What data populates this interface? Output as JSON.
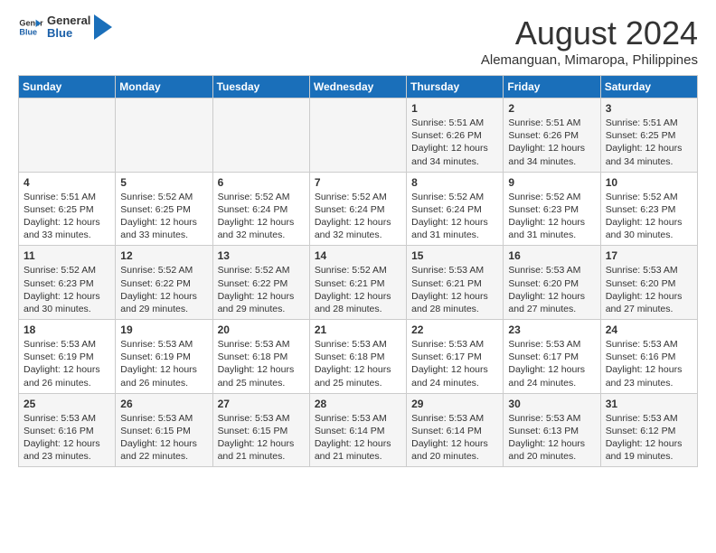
{
  "header": {
    "logo_line1": "General",
    "logo_line2": "Blue",
    "title": "August 2024",
    "subtitle": "Alemanguan, Mimaropa, Philippines"
  },
  "days_of_week": [
    "Sunday",
    "Monday",
    "Tuesday",
    "Wednesday",
    "Thursday",
    "Friday",
    "Saturday"
  ],
  "weeks": [
    [
      {
        "date": "",
        "info": ""
      },
      {
        "date": "",
        "info": ""
      },
      {
        "date": "",
        "info": ""
      },
      {
        "date": "",
        "info": ""
      },
      {
        "date": "1",
        "info": "Sunrise: 5:51 AM\nSunset: 6:26 PM\nDaylight: 12 hours\nand 34 minutes."
      },
      {
        "date": "2",
        "info": "Sunrise: 5:51 AM\nSunset: 6:26 PM\nDaylight: 12 hours\nand 34 minutes."
      },
      {
        "date": "3",
        "info": "Sunrise: 5:51 AM\nSunset: 6:25 PM\nDaylight: 12 hours\nand 34 minutes."
      }
    ],
    [
      {
        "date": "4",
        "info": "Sunrise: 5:51 AM\nSunset: 6:25 PM\nDaylight: 12 hours\nand 33 minutes."
      },
      {
        "date": "5",
        "info": "Sunrise: 5:52 AM\nSunset: 6:25 PM\nDaylight: 12 hours\nand 33 minutes."
      },
      {
        "date": "6",
        "info": "Sunrise: 5:52 AM\nSunset: 6:24 PM\nDaylight: 12 hours\nand 32 minutes."
      },
      {
        "date": "7",
        "info": "Sunrise: 5:52 AM\nSunset: 6:24 PM\nDaylight: 12 hours\nand 32 minutes."
      },
      {
        "date": "8",
        "info": "Sunrise: 5:52 AM\nSunset: 6:24 PM\nDaylight: 12 hours\nand 31 minutes."
      },
      {
        "date": "9",
        "info": "Sunrise: 5:52 AM\nSunset: 6:23 PM\nDaylight: 12 hours\nand 31 minutes."
      },
      {
        "date": "10",
        "info": "Sunrise: 5:52 AM\nSunset: 6:23 PM\nDaylight: 12 hours\nand 30 minutes."
      }
    ],
    [
      {
        "date": "11",
        "info": "Sunrise: 5:52 AM\nSunset: 6:23 PM\nDaylight: 12 hours\nand 30 minutes."
      },
      {
        "date": "12",
        "info": "Sunrise: 5:52 AM\nSunset: 6:22 PM\nDaylight: 12 hours\nand 29 minutes."
      },
      {
        "date": "13",
        "info": "Sunrise: 5:52 AM\nSunset: 6:22 PM\nDaylight: 12 hours\nand 29 minutes."
      },
      {
        "date": "14",
        "info": "Sunrise: 5:52 AM\nSunset: 6:21 PM\nDaylight: 12 hours\nand 28 minutes."
      },
      {
        "date": "15",
        "info": "Sunrise: 5:53 AM\nSunset: 6:21 PM\nDaylight: 12 hours\nand 28 minutes."
      },
      {
        "date": "16",
        "info": "Sunrise: 5:53 AM\nSunset: 6:20 PM\nDaylight: 12 hours\nand 27 minutes."
      },
      {
        "date": "17",
        "info": "Sunrise: 5:53 AM\nSunset: 6:20 PM\nDaylight: 12 hours\nand 27 minutes."
      }
    ],
    [
      {
        "date": "18",
        "info": "Sunrise: 5:53 AM\nSunset: 6:19 PM\nDaylight: 12 hours\nand 26 minutes."
      },
      {
        "date": "19",
        "info": "Sunrise: 5:53 AM\nSunset: 6:19 PM\nDaylight: 12 hours\nand 26 minutes."
      },
      {
        "date": "20",
        "info": "Sunrise: 5:53 AM\nSunset: 6:18 PM\nDaylight: 12 hours\nand 25 minutes."
      },
      {
        "date": "21",
        "info": "Sunrise: 5:53 AM\nSunset: 6:18 PM\nDaylight: 12 hours\nand 25 minutes."
      },
      {
        "date": "22",
        "info": "Sunrise: 5:53 AM\nSunset: 6:17 PM\nDaylight: 12 hours\nand 24 minutes."
      },
      {
        "date": "23",
        "info": "Sunrise: 5:53 AM\nSunset: 6:17 PM\nDaylight: 12 hours\nand 24 minutes."
      },
      {
        "date": "24",
        "info": "Sunrise: 5:53 AM\nSunset: 6:16 PM\nDaylight: 12 hours\nand 23 minutes."
      }
    ],
    [
      {
        "date": "25",
        "info": "Sunrise: 5:53 AM\nSunset: 6:16 PM\nDaylight: 12 hours\nand 23 minutes."
      },
      {
        "date": "26",
        "info": "Sunrise: 5:53 AM\nSunset: 6:15 PM\nDaylight: 12 hours\nand 22 minutes."
      },
      {
        "date": "27",
        "info": "Sunrise: 5:53 AM\nSunset: 6:15 PM\nDaylight: 12 hours\nand 21 minutes."
      },
      {
        "date": "28",
        "info": "Sunrise: 5:53 AM\nSunset: 6:14 PM\nDaylight: 12 hours\nand 21 minutes."
      },
      {
        "date": "29",
        "info": "Sunrise: 5:53 AM\nSunset: 6:14 PM\nDaylight: 12 hours\nand 20 minutes."
      },
      {
        "date": "30",
        "info": "Sunrise: 5:53 AM\nSunset: 6:13 PM\nDaylight: 12 hours\nand 20 minutes."
      },
      {
        "date": "31",
        "info": "Sunrise: 5:53 AM\nSunset: 6:12 PM\nDaylight: 12 hours\nand 19 minutes."
      }
    ]
  ]
}
